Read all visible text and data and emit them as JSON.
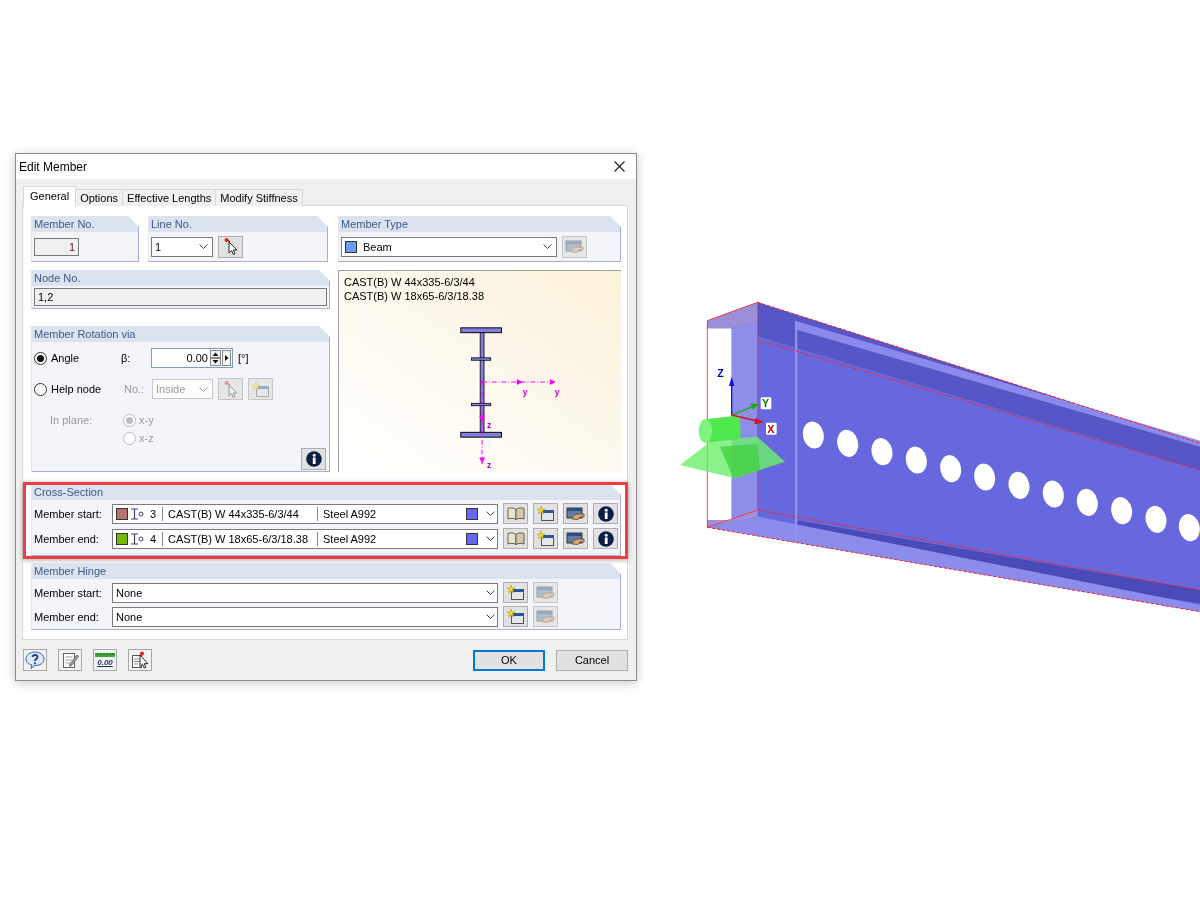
{
  "window": {
    "title": "Edit Member"
  },
  "tabs": [
    {
      "label": "General",
      "selected": true
    },
    {
      "label": "Options",
      "selected": false
    },
    {
      "label": "Effective Lengths",
      "selected": false
    },
    {
      "label": "Modify Stiffness",
      "selected": false
    }
  ],
  "member_no": {
    "title": "Member No.",
    "value": "1"
  },
  "line_no": {
    "title": "Line No.",
    "value": "1"
  },
  "member_type": {
    "title": "Member Type",
    "value": "Beam",
    "edit_disabled": true
  },
  "node_no": {
    "title": "Node No.",
    "value": "1,2"
  },
  "member_rotation": {
    "title": "Member Rotation via",
    "options": [
      {
        "label": "Angle",
        "selected": true
      },
      {
        "label": "Help node",
        "selected": false
      }
    ],
    "beta_label": "β:",
    "beta_value": "0.00",
    "beta_unit": "[°]",
    "node_label": "No.:",
    "node_value": "Inside",
    "help_node_disabled": true,
    "plane_label": "In plane:",
    "planes": [
      {
        "label": "x-y",
        "selected": true
      },
      {
        "label": "x-z",
        "selected": false
      }
    ]
  },
  "preview": {
    "lines": [
      "CAST(B) W 44x335-6/3/44",
      "CAST(B) W 18x65-6/3/18.38"
    ],
    "axis_labels": [
      "y",
      "y",
      "z",
      "z"
    ]
  },
  "cross_section": {
    "title": "Cross-Section",
    "highlighted": true,
    "rows": [
      {
        "label": "Member start:",
        "color": "#b87272",
        "number": "3",
        "name": "CAST(B) W 44x335-6/3/44",
        "material": "Steel A992"
      },
      {
        "label": "Member end:",
        "color": "#76b900",
        "number": "4",
        "name": "CAST(B) W 18x65-6/3/18.38",
        "material": "Steel A992"
      }
    ]
  },
  "member_hinge": {
    "title": "Member Hinge",
    "rows": [
      {
        "label": "Member start:",
        "value": "None",
        "edit_disabled": true
      },
      {
        "label": "Member end:",
        "value": "None",
        "edit_disabled": true
      }
    ]
  },
  "tools": [
    {
      "kind": "help"
    },
    {
      "kind": "notes"
    },
    {
      "kind": "units",
      "label": "0.00"
    },
    {
      "kind": "pick"
    }
  ],
  "buttons": [
    {
      "label": "OK",
      "default": true
    },
    {
      "label": "Cancel",
      "default": false
    }
  ],
  "model_view": {
    "axis_labels": [
      "Z",
      "Y",
      "X"
    ]
  }
}
